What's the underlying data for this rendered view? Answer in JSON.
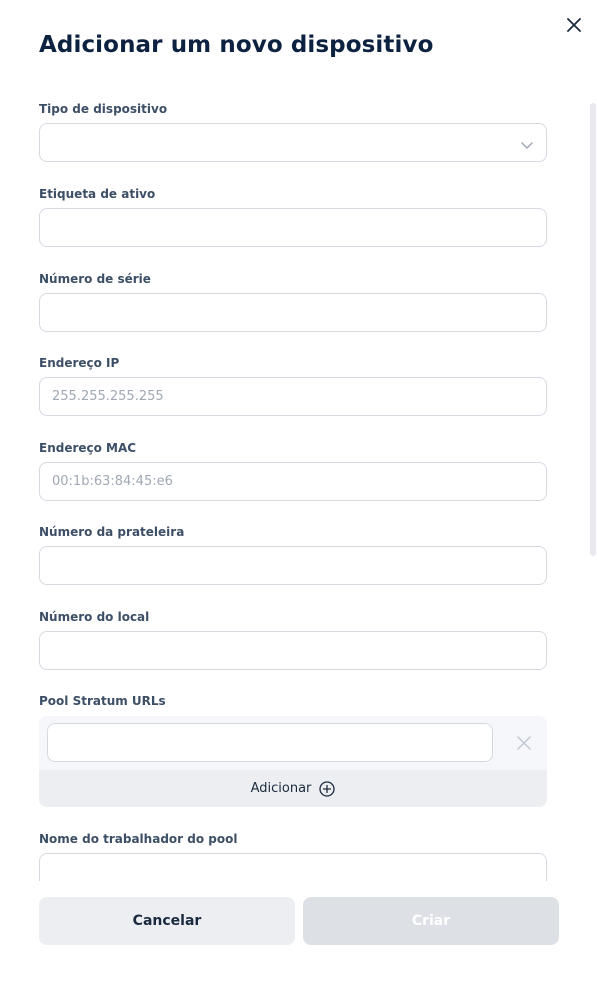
{
  "dialog": {
    "title": "Adicionar um novo dispositivo"
  },
  "fields": {
    "device_type": {
      "label": "Tipo de dispositivo",
      "value": ""
    },
    "asset_tag": {
      "label": "Etiqueta de ativo",
      "value": ""
    },
    "serial_number": {
      "label": "Número de série",
      "value": ""
    },
    "ip_address": {
      "label": "Endereço IP",
      "placeholder": "255.255.255.255"
    },
    "mac_address": {
      "label": "Endereço MAC",
      "placeholder": "00:1b:63:84:45:e6"
    },
    "shelf_number": {
      "label": "Número da prateleira",
      "value": ""
    },
    "location_number": {
      "label": "Número do local",
      "value": ""
    },
    "pool_urls": {
      "label": "Pool Stratum URLs",
      "add_label": "Adicionar"
    },
    "pool_worker": {
      "label": "Nome do trabalhador do pool",
      "value": ""
    }
  },
  "footer": {
    "cancel_label": "Cancelar",
    "create_label": "Criar"
  },
  "icons": {
    "close": "close-icon",
    "chevron": "chevron-down-icon",
    "remove": "remove-url-icon",
    "add": "plus-circle-icon"
  }
}
